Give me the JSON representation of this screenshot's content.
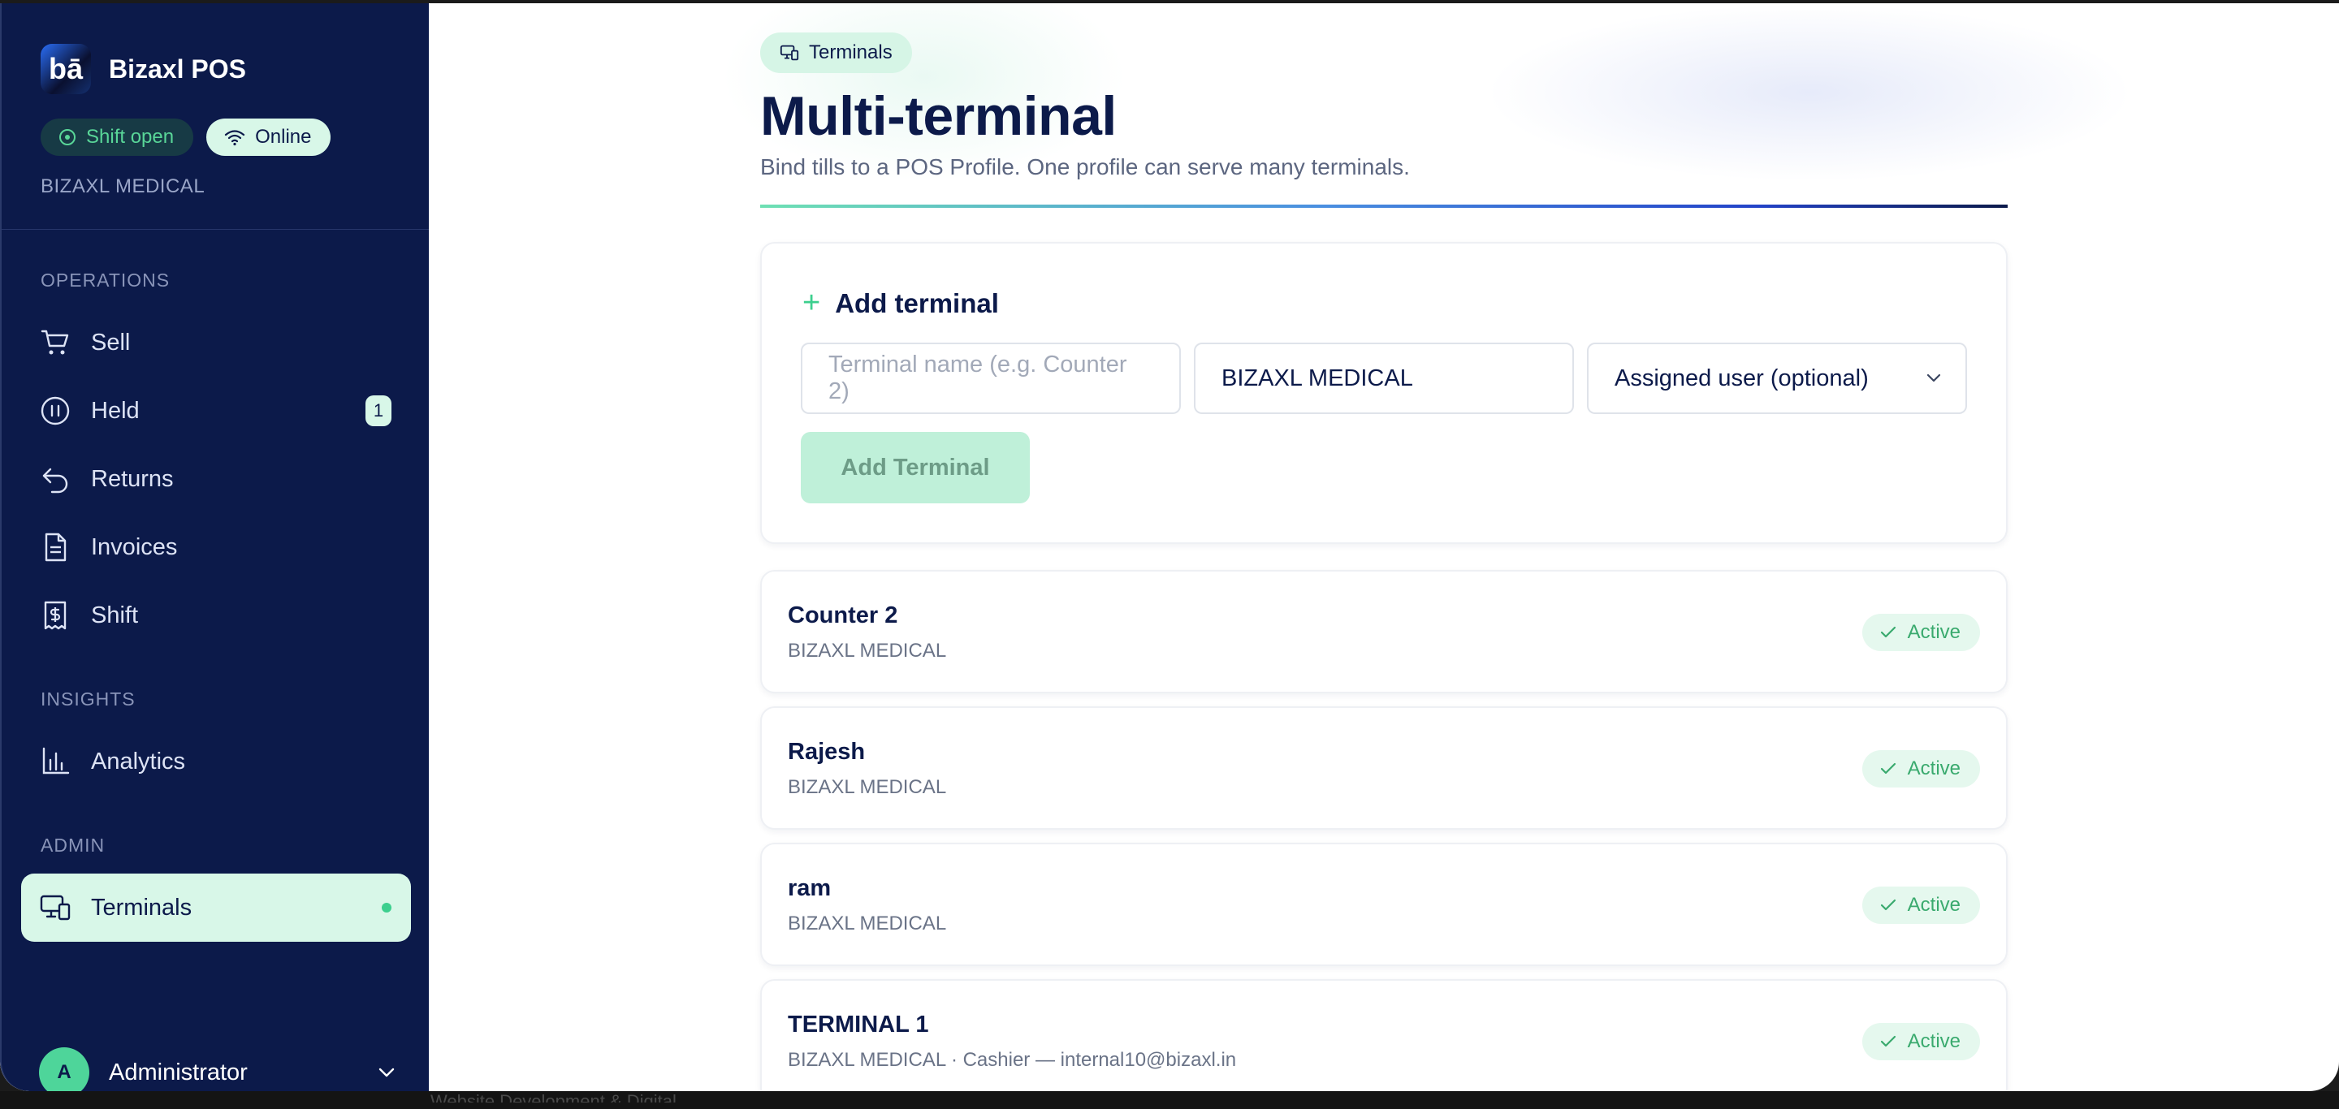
{
  "app": {
    "brand_name": "Bizaxl POS",
    "logo_text": "bā",
    "shift_status": "Shift open",
    "connection_status": "Online",
    "company": "BIZAXL MEDICAL"
  },
  "sidebar": {
    "sections": {
      "operations": "OPERATIONS",
      "insights": "INSIGHTS",
      "admin": "ADMIN"
    },
    "items": [
      {
        "label": "Sell",
        "icon": "cart-icon"
      },
      {
        "label": "Held",
        "icon": "pause-icon",
        "badge": "1"
      },
      {
        "label": "Returns",
        "icon": "undo-icon"
      },
      {
        "label": "Invoices",
        "icon": "document-icon"
      },
      {
        "label": "Shift",
        "icon": "receipt-dollar-icon"
      },
      {
        "label": "Analytics",
        "icon": "bar-chart-icon"
      },
      {
        "label": "Terminals",
        "icon": "devices-icon",
        "active": true
      }
    ],
    "user": {
      "initial": "A",
      "name": "Administrator"
    }
  },
  "page": {
    "chip": "Terminals",
    "title": "Multi-terminal",
    "subtitle": "Bind tills to a POS Profile. One profile can serve many terminals."
  },
  "add_form": {
    "heading": "Add terminal",
    "name_placeholder": "Terminal name (e.g. Counter 2)",
    "profile_value": "BIZAXL MEDICAL",
    "user_select": "Assigned user (optional)",
    "submit_label": "Add Terminal"
  },
  "terminals": [
    {
      "name": "Counter 2",
      "detail": "BIZAXL MEDICAL",
      "status": "Active"
    },
    {
      "name": "Rajesh",
      "detail": "BIZAXL MEDICAL",
      "status": "Active"
    },
    {
      "name": "ram",
      "detail": "BIZAXL MEDICAL",
      "status": "Active"
    },
    {
      "name": "TERMINAL 1",
      "detail": "BIZAXL MEDICAL · Cashier — internal10@bizaxl.in",
      "status": "Active"
    }
  ],
  "colors": {
    "sidebar_bg": "#0c1a4a",
    "accent": "#3ccf8e",
    "active_bg": "#d8f7e8",
    "status_green": "#3aaa6e"
  },
  "footer_text": "Website Development & Digital..."
}
